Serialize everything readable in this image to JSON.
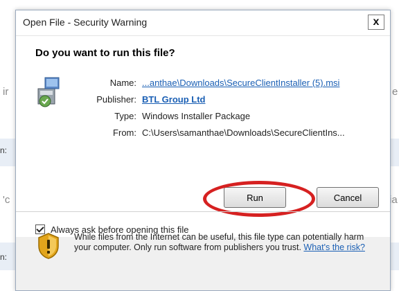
{
  "background": {
    "fragments": [
      "ir",
      "e",
      "n:",
      "'c",
      "ia",
      "n:"
    ]
  },
  "dialog": {
    "title": "Open File - Security Warning",
    "close_label": "x",
    "question": "Do you want to run this file?",
    "icon": "installer-package-icon",
    "fields": {
      "name_label": "Name:",
      "name_value": "...anthae\\Downloads\\SecureClientInstaller (5).msi",
      "publisher_label": "Publisher:",
      "publisher_value": "BTL Group Ltd",
      "type_label": "Type:",
      "type_value": "Windows Installer Package",
      "from_label": "From:",
      "from_value": "C:\\Users\\samanthae\\Downloads\\SecureClientIns..."
    },
    "buttons": {
      "run": "Run",
      "cancel": "Cancel"
    },
    "checkbox": {
      "label": "Always ask before opening this file",
      "checked": true
    },
    "warning": {
      "icon": "security-shield-icon",
      "text": "While files from the Internet can be useful, this file type can potentially harm your computer. Only run software from publishers you trust.",
      "link": "What's the risk?"
    },
    "annotation_color": "#d62121"
  }
}
